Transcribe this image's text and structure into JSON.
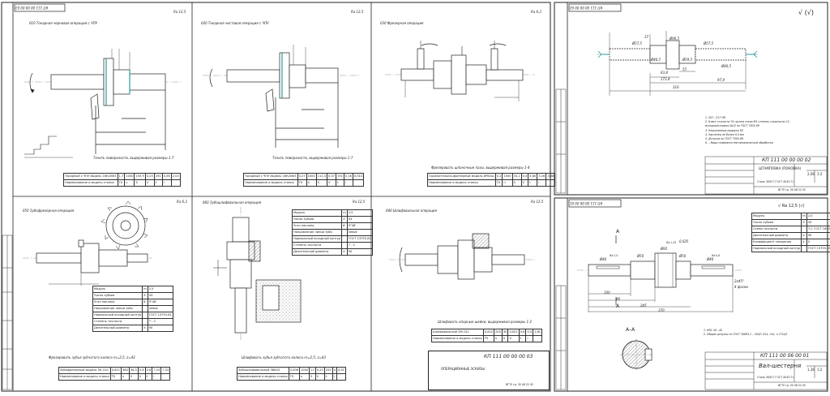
{
  "sheet_left": {
    "code_stamp": "КП 111 00 00 00 03",
    "title_stamp": "КП 111 00 00 00 03",
    "op_010": "010 Токарная черновая операция с ЧПУ",
    "op_020": "020 Токарная чистовая операция с ЧПУ",
    "op_030": "030 Фрезерная операция",
    "op_040": "040 Шлифовальная операция",
    "op_050": "050 Зубофрезерная операция",
    "op_060": "060 Зубошлифовальная операция",
    "caption_010": "Точить поверхности, выдерживая размеры 1-7",
    "caption_020": "Точить поверхности, выдерживая размеры 1-7",
    "caption_030": "Фрезеровать шпоночные пазы, выдерживая размеры 1-4",
    "caption_040": "Шлифовать опорные шейки, выдерживая размеры 1-2",
    "caption_050": "Фрезеровать зубья зубчатого колеса m=2,5; z=43",
    "caption_060": "Шлифовать зубья зубчатого колеса m=2,5; z=43",
    "rough_010": "Ra 12,5",
    "rough_020": "Ra 12,5",
    "rough_030": "Ra 6,3",
    "rough_040": "Ra 12,5",
    "rough_050": "Ra 6,3",
    "rough_060": "Ra 12,5",
    "machine_010": "Токарный с ЧПУ модель 16К20Ф3",
    "machine_020": "Токарный с ЧПУ модель 16К20Ф3",
    "machine_030": "Горизонтально-фрезерный модель 6Р82Ш",
    "machine_040": "Шлифовальный ЗМ-151",
    "machine_050": "Зубофрезерный модель 5К-310",
    "machine_060": "Зубошлифовальный 5В833",
    "doc_title": "ОПЕРАЦИОННЫЕ ЭСКИЗЫ",
    "group": "ВГТУ гр. 30 08 22 92"
  },
  "left_tables": {
    "row_labels": [
      "Наименование и модель станка",
      "T0",
      "n",
      "S",
      "V",
      "t",
      "i"
    ],
    "op_010_vals": [
      "1,7",
      "1000",
      "155,9",
      "0,25",
      "250",
      "0,56",
      "2,03"
    ],
    "op_020_vals": [
      "0,27",
      "1000",
      "111,3",
      "0,07",
      "192",
      "0,16",
      "0,014"
    ],
    "op_030_vals": [
      "0,2",
      "1000",
      "33,1",
      "0,4",
      "4,80",
      "3,16",
      "3,88"
    ],
    "op_040_vals": [
      "0,002",
      "200",
      "30",
      "0,001",
      "0,6",
      "0,5",
      "1,82"
    ],
    "op_050_vals": [
      "0,621",
      "380",
      "56,5",
      "0,6",
      "0,6",
      "7,23",
      "7,53"
    ],
    "op_060_vals": [
      "0,006",
      "1000",
      "11",
      "0,25",
      "250",
      "4",
      "4,51"
    ]
  },
  "gear_table_050": {
    "rows": [
      [
        "Модуль",
        "m",
        "2,5"
      ],
      [
        "Число зубьев",
        "Z",
        "43"
      ],
      [
        "Угол наклона",
        "β",
        "9°48'"
      ],
      [
        "Направление линии зуба",
        "",
        "левое"
      ],
      [
        "Нормальный исходный контур",
        "",
        "ГОСТ 13755-81"
      ],
      [
        "Степень точности",
        "",
        "7 - С"
      ],
      [
        "Делительный диаметр",
        "d",
        "90"
      ]
    ]
  },
  "gear_table_060": {
    "rows": [
      [
        "Модуль",
        "m",
        "2,5"
      ],
      [
        "Число зубьев",
        "Z",
        "43"
      ],
      [
        "Угол наклона",
        "β",
        "9°48'"
      ],
      [
        "Направление линии зуба",
        "",
        "левое"
      ],
      [
        "Нормальный исходный контур",
        "",
        "ГОСТ 13755-81"
      ],
      [
        "Степень точности",
        "",
        "7 - С"
      ],
      [
        "Делительный диаметр",
        "d",
        "90"
      ]
    ]
  },
  "sheet_top_right": {
    "code_stamp": "КП 111 00 00 00 02",
    "title_stamp": "КП 111 00 00 00 02",
    "doc_title": "ШТАМПОВКА (ПОКОВКА)",
    "material": "Сталь 30ХГС ГОСТ 4543-71",
    "group": "ВГТУ гр. 30 08 22 92",
    "mass": "2,06",
    "scale": "1:2",
    "rough_sign": "√ (√)",
    "notes": [
      "1. 207...217 НВ",
      "2. Класс точности Т4 группа стали М1 степень сложности С2,",
      "исходный индекс №12 по ГОСТ 7505-89",
      "3. Неуказанные радиусы R2",
      "4. Заусенец не более 0,5 мм",
      "5. Допуски по ГОСТ 7505-89",
      "6. – Виды поверхностей механической обработки"
    ],
    "dims": [
      "Ø57,5",
      "Ø40,5",
      "Ø59,5",
      "Ø96,5",
      "Ø57,5",
      "Ø40,5",
      "37",
      "63,4",
      "173,4",
      "55",
      "97,4",
      "316"
    ]
  },
  "sheet_bottom_right": {
    "code_stamp": "КП 111 00 06 00 01",
    "title_stamp": "КП 111 00 06 00 01",
    "doc_title": "Вал-шестерня",
    "material": "Сталь 30ХГС ГОСТ 4543-71",
    "group": "ВГТУ гр. 30 08 22 92",
    "mass": "1,36",
    "scale": "1:2",
    "rough_sign": "√ Ra 12,5 (√)",
    "section_label": "А–А",
    "arrow_a": "А",
    "notes": [
      "1. НRC 40...45",
      "2. Общие допуски по ГОСТ 30893.1 – 2002: H14, h14, ± IT14/2"
    ],
    "gear_rows": [
      [
        "Модуль",
        "m",
        "2,0"
      ],
      [
        "Число зубьев",
        "Z",
        "43"
      ],
      [
        "Схема точности",
        "",
        "7-С ГОСТ 1643-81"
      ],
      [
        "Делительный диаметр",
        "d",
        "90"
      ],
      [
        "Коэффициент смещения",
        "x",
        "0"
      ],
      [
        "Нормальный исходный контур",
        "",
        "ГОСТ 13755-81"
      ]
    ],
    "dims": [
      "Ø40",
      "Ø50",
      "Ø92",
      "Ø50",
      "Ø40",
      "100",
      "90",
      "245",
      "370",
      "2x45°",
      "4 фаски",
      "0,025",
      "Ra 2,5",
      "Ra 1,25",
      "Ra 0,8"
    ]
  },
  "colors": {
    "line": "#222222",
    "thin": "#555555",
    "center": "#777777",
    "part_fill": "#ffffff",
    "accent_teal": "#2a9d9d",
    "hatch": "#444444"
  }
}
